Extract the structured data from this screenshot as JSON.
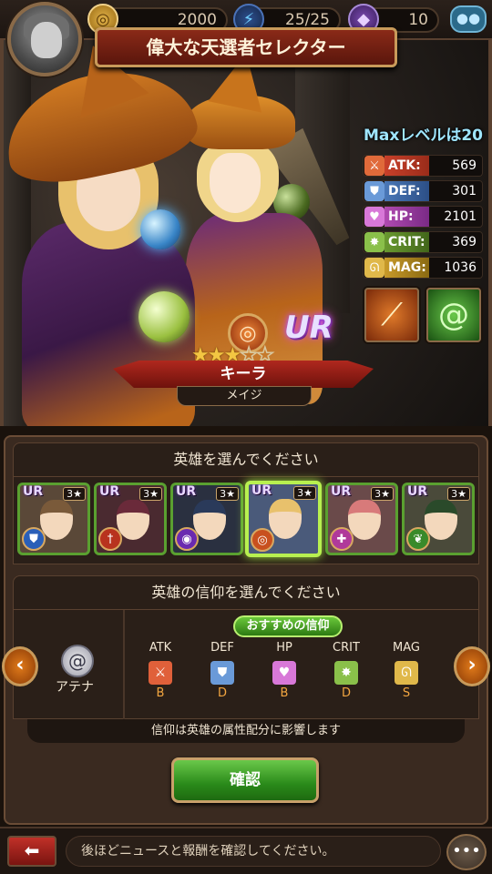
{
  "hud": {
    "coins": "2000",
    "energy": "25/25",
    "gems": "10"
  },
  "title": "偉大な天選者セレクター",
  "hero": {
    "max_level": "Maxレベルは20",
    "rarity": "UR",
    "stars": 3,
    "max_stars": 5,
    "name": "キーラ",
    "class": "メイジ",
    "stats": [
      {
        "label": "ATK:",
        "value": "569",
        "icon": "sword-icon"
      },
      {
        "label": "DEF:",
        "value": "301",
        "icon": "shield-icon"
      },
      {
        "label": "HP:",
        "value": "2101",
        "icon": "heart-icon"
      },
      {
        "label": "CRIT:",
        "value": "369",
        "icon": "crit-icon"
      },
      {
        "label": "MAG:",
        "value": "1036",
        "icon": "magic-icon"
      }
    ]
  },
  "select_hero": {
    "heading": "英雄を選んでください",
    "cards": [
      {
        "rarity": "UR",
        "level": "3★",
        "class_icon": "shield-class-icon",
        "class_color": "#2a5fb8",
        "hair": "#7a5a3a",
        "bg": "#5a4838"
      },
      {
        "rarity": "UR",
        "level": "3★",
        "class_icon": "sword-class-icon",
        "class_color": "#b8321e",
        "hair": "#6a2a3a",
        "bg": "#4a2a30"
      },
      {
        "rarity": "UR",
        "level": "3★",
        "class_icon": "mask-class-icon",
        "class_color": "#6a2ab0",
        "hair": "#2a3a5a",
        "bg": "#2a3040"
      },
      {
        "rarity": "UR",
        "level": "3★",
        "class_icon": "spiral-class-icon",
        "class_color": "#c8501e",
        "hair": "#e8c16c",
        "bg": "#4a5a7a"
      },
      {
        "rarity": "UR",
        "level": "3★",
        "class_icon": "cross-class-icon",
        "class_color": "#b03a9a",
        "hair": "#d87a7a",
        "bg": "#6a4a4a"
      },
      {
        "rarity": "UR",
        "level": "3★",
        "class_icon": "leaf-class-icon",
        "class_color": "#3a8a2a",
        "hair": "#2a4a2a",
        "bg": "#4a4a3a"
      }
    ]
  },
  "faith": {
    "heading": "英雄の信仰を選んでください",
    "deity": "アテナ",
    "recommend": "おすすめの信仰",
    "attributes": [
      {
        "name": "ATK",
        "grade": "B",
        "color": "#e0603a",
        "icon": "sword-icon"
      },
      {
        "name": "DEF",
        "grade": "D",
        "color": "#6a9ad8",
        "icon": "shield-icon"
      },
      {
        "name": "HP",
        "grade": "B",
        "color": "#d878d8",
        "icon": "heart-icon"
      },
      {
        "name": "CRIT",
        "grade": "D",
        "color": "#8ac04a",
        "icon": "crit-icon"
      },
      {
        "name": "MAG",
        "grade": "S",
        "color": "#e0b84a",
        "icon": "magic-icon"
      }
    ],
    "note": "信仰は英雄の属性配分に影響します"
  },
  "confirm_label": "確認",
  "news_text": "後ほどニュースと報酬を確認してください。"
}
